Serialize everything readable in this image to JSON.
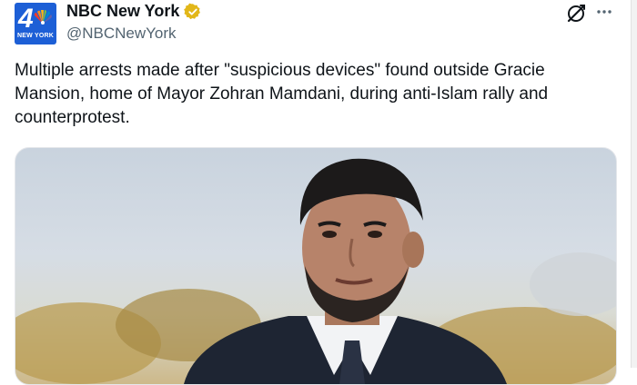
{
  "account": {
    "avatar_number": "4",
    "avatar_tag": "NEW YORK",
    "display_name": "NBC New York",
    "handle": "@NBCNewYork"
  },
  "post": {
    "text": "Multiple arrests made after \"suspicious devices\" found outside Gracie Mansion, home of Mayor Zohran Mamdani, during anti-Islam rally and counterprotest."
  },
  "icons": {
    "verified": "verified-badge-gold",
    "grok": "grok-icon",
    "more": "more-icon"
  },
  "colors": {
    "avatar_bg": "#1d5fd6",
    "verified_gold": "#e2b719",
    "text": "#0f1419",
    "secondary": "#536471"
  }
}
